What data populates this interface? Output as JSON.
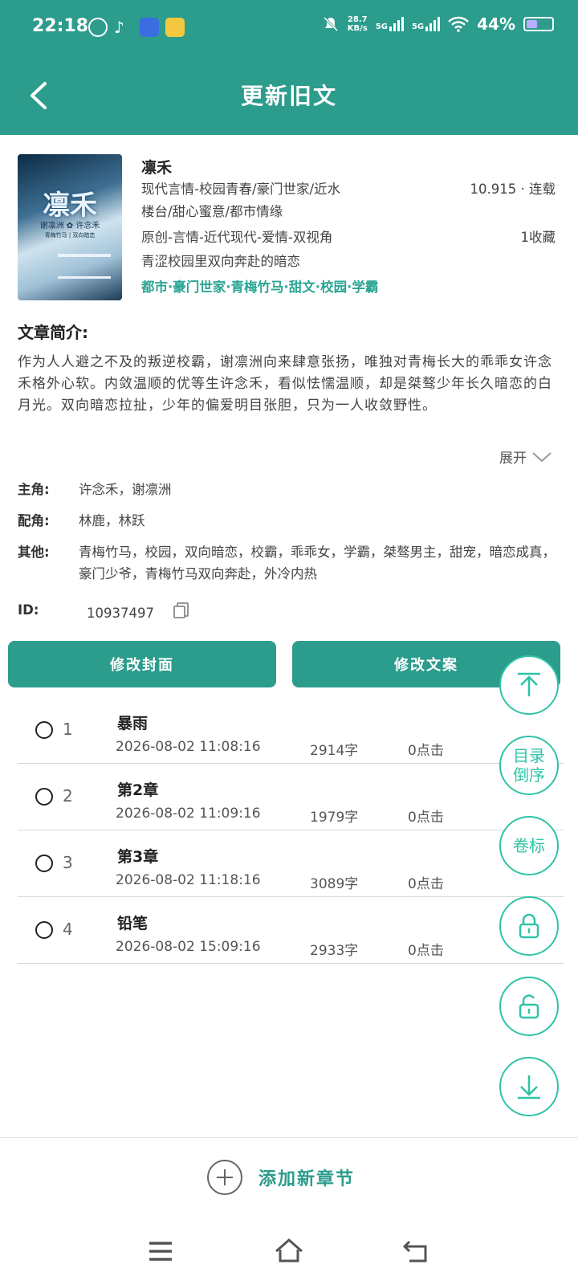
{
  "status": {
    "time": "22:18",
    "net_speed_value": "28.7",
    "net_speed_unit": "KB/s",
    "sim1": "5G",
    "sim2": "5G",
    "battery": "44%",
    "battery_level": 0.44
  },
  "header": {
    "title": "更新旧文"
  },
  "book": {
    "title": "凛禾",
    "cover_title": "凛禾",
    "cover_sub": "谢凛洲 ✿ 许念禾",
    "cover_sub2": "青梅竹马 | 双向暗恋",
    "genre_line1": "现代言情-校园青春/豪门世家/近水",
    "genre_line2": "楼台/甜心蜜意/都市情缘",
    "stats": "10.915 · 连载",
    "type_line": "原创-言情-近代现代-爱情-双视角",
    "favorites": "1收藏",
    "tagline": "青涩校园里双向奔赴的暗恋",
    "tags": "都市·豪门世家·青梅竹马·甜文·校园·学霸"
  },
  "intro": {
    "heading": "文章简介:",
    "text": "作为人人避之不及的叛逆校霸，谢凛洲向来肆意张扬，唯独对青梅长大的乖乖女许念禾格外心软。内敛温顺的优等生许念禾，看似怯懦温顺，却是桀骜少年长久暗恋的白月光。双向暗恋拉扯，少年的偏爱明目张胆，只为一人收敛野性。",
    "expand_label": "展开"
  },
  "meta": {
    "lead_label": "主角:",
    "lead_value": "许念禾，谢凛洲",
    "support_label": "配角:",
    "support_value": "林鹿，林跃",
    "other_label": "其他:",
    "other_value": "青梅竹马，校园，双向暗恋，校霸，乖乖女，学霸，桀骜男主，甜宠，暗恋成真，豪门少爷，青梅竹马双向奔赴，外冷内热",
    "id_label": "ID:",
    "id_value": "10937497"
  },
  "buttons": {
    "edit_cover": "修改封面",
    "edit_copy": "修改文案"
  },
  "chapters": [
    {
      "num": "1",
      "title": "暴雨",
      "date": "2026-08-02 11:08:16",
      "words": "2914字",
      "clicks": "0点击"
    },
    {
      "num": "2",
      "title": "第2章",
      "date": "2026-08-02 11:09:16",
      "words": "1979字",
      "clicks": "0点击"
    },
    {
      "num": "3",
      "title": "第3章",
      "date": "2026-08-02 11:18:16",
      "words": "3089字",
      "clicks": "0点击"
    },
    {
      "num": "4",
      "title": "铅笔",
      "date": "2026-08-02 15:09:16",
      "words": "2933字",
      "clicks": "0点击"
    }
  ],
  "fabs": {
    "reverse_line1": "目录",
    "reverse_line2": "倒序",
    "volume": "卷标"
  },
  "footer": {
    "add_chapter": "添加新章节"
  },
  "colors": {
    "primary": "#2c9c8c",
    "accent": "#2ec4a6",
    "tag": "#2aa594"
  }
}
